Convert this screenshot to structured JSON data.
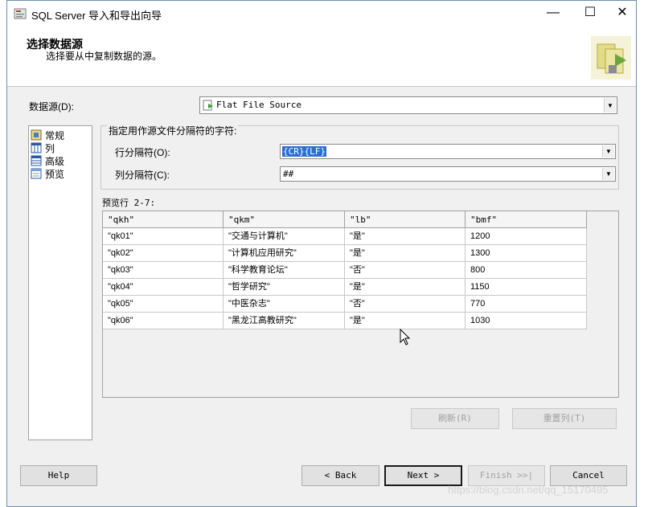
{
  "window": {
    "title": "SQL Server 导入和导出向导",
    "minimize": "—",
    "maximize": "☐",
    "close": "✕"
  },
  "header": {
    "title": "选择数据源",
    "subtitle": "选择要从中复制数据的源。"
  },
  "data_source": {
    "label": "数据源(D):",
    "value": "Flat File Source"
  },
  "sidebar": {
    "items": [
      {
        "label": "常规",
        "icon": "general-icon"
      },
      {
        "label": "列",
        "icon": "columns-icon"
      },
      {
        "label": "高级",
        "icon": "advanced-icon"
      },
      {
        "label": "预览",
        "icon": "preview-icon"
      }
    ]
  },
  "delimiters": {
    "group_title": "指定用作源文件分隔符的字符:",
    "row_label": "行分隔符(O):",
    "row_value": "{CR}{LF}",
    "col_label": "列分隔符(C):",
    "col_value": "##"
  },
  "preview": {
    "label": "预览行 2-7:",
    "columns": [
      "\"qkh\"",
      "\"qkm\"",
      "\"lb\"",
      "\"bmf\""
    ],
    "rows": [
      [
        "\"qk01\"",
        "\"交通与计算机\"",
        "\"是\"",
        "1200"
      ],
      [
        "\"qk02\"",
        "\"计算机应用研究\"",
        "\"是\"",
        "1300"
      ],
      [
        "\"qk03\"",
        "\"科学教育论坛\"",
        "\"否\"",
        "800"
      ],
      [
        "\"qk04\"",
        "\"哲学研究\"",
        "\"是\"",
        "1150"
      ],
      [
        "\"qk05\"",
        "\"中医杂志\"",
        "\"否\"",
        "770"
      ],
      [
        "\"qk06\"",
        "\"黑龙江高教研究\"",
        "\"是\"",
        "1030"
      ]
    ]
  },
  "buttons": {
    "refresh": "刷新(R)",
    "reset_columns": "重置列(T)",
    "help": "Help",
    "back": "< Back",
    "next": "Next >",
    "finish": "Finish >>|",
    "cancel": "Cancel"
  },
  "watermark": "https://blog.csdn.net/qq_15170495"
}
